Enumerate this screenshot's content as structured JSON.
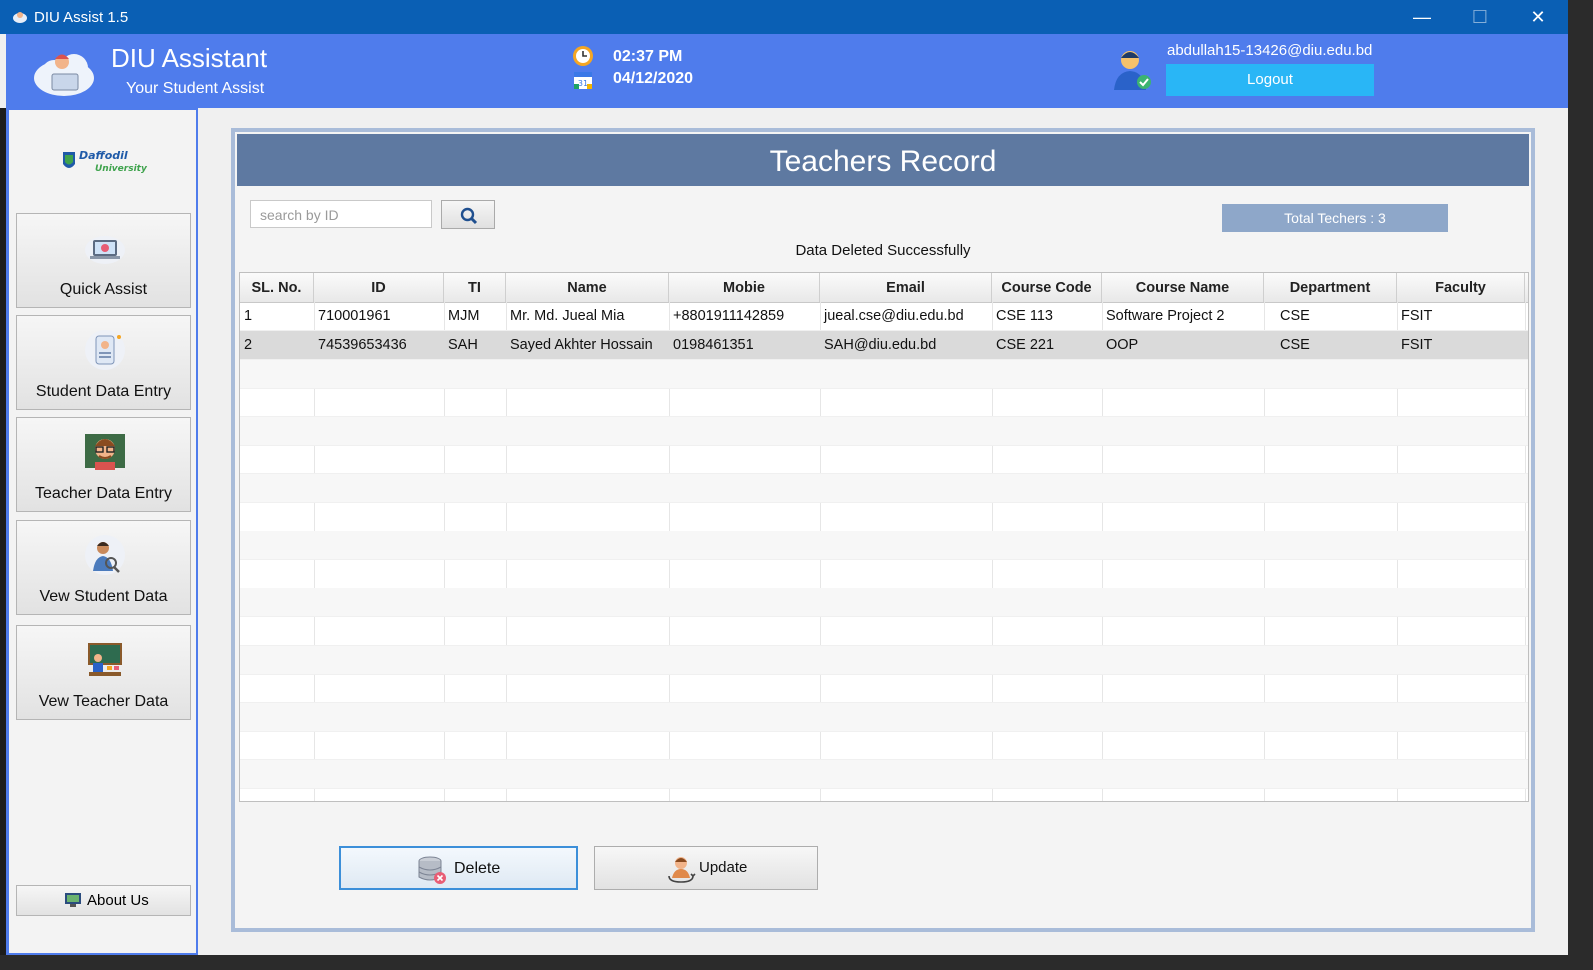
{
  "window": {
    "title": "DIU Assist 1.5",
    "minimize": "—",
    "maximize": "☐",
    "close": "✕"
  },
  "header": {
    "app_name": "DIU Assistant",
    "app_subtitle": "Your Student Assist",
    "time": "02:37 PM",
    "date": "04/12/2020",
    "user_email": "abdullah15-13426@diu.edu.bd",
    "logout_label": "Logout"
  },
  "sidebar": {
    "items": [
      {
        "label": "Quick Assist",
        "icon": "laptop-assist-icon"
      },
      {
        "label": "Student Data Entry",
        "icon": "id-card-icon"
      },
      {
        "label": "Teacher Data Entry",
        "icon": "teacher-icon"
      },
      {
        "label": "Vew Student Data",
        "icon": "student-search-icon"
      },
      {
        "label": "Vew Teacher Data",
        "icon": "classroom-icon"
      }
    ],
    "about_label": "About Us"
  },
  "main": {
    "title": "Teachers Record",
    "search_placeholder": "search by ID",
    "total_label": "Total Techers : 3",
    "status_message": "Data Deleted Successfully",
    "columns": [
      "SL. No.",
      "ID",
      "TI",
      "Name",
      "Mobie",
      "Email",
      "Course Code",
      "Course Name",
      "Department",
      "Faculty"
    ],
    "rows": [
      [
        "1",
        "710001961",
        "MJM",
        "Mr. Md. Jueal Mia",
        "+8801911142859",
        "jueal.cse@diu.edu.bd",
        "CSE 113",
        "Software Project 2",
        "CSE",
        "FSIT"
      ],
      [
        "2",
        "74539653436",
        "SAH",
        "Sayed Akhter Hossain",
        "0198461351",
        "SAH@diu.edu.bd",
        "CSE 221",
        "OOP",
        "CSE",
        "FSIT"
      ]
    ],
    "delete_label": "Delete",
    "update_label": "Update"
  },
  "colors": {
    "titlebar": "#0a5fb4",
    "header": "#4f7cec",
    "panel_title": "#5e79a1",
    "logout": "#29b6f6"
  }
}
